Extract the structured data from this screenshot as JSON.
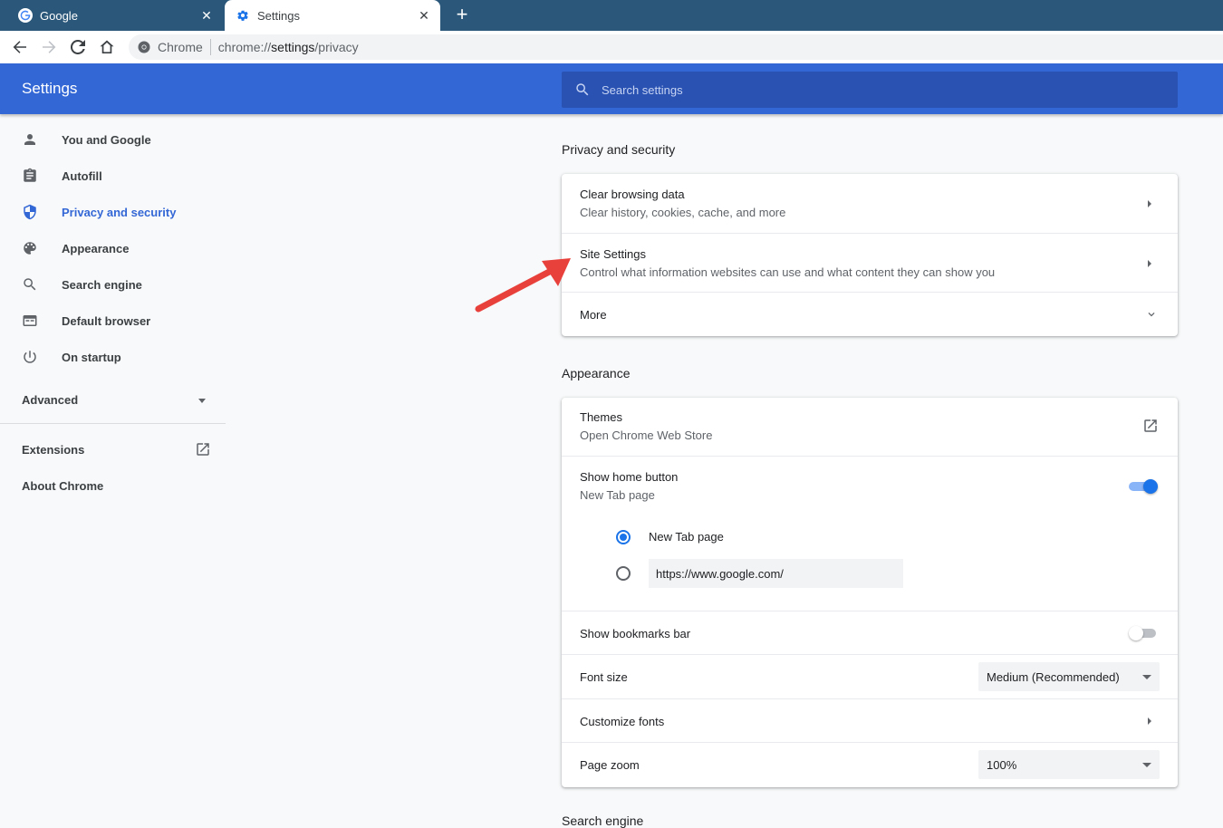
{
  "browser": {
    "tabs": [
      {
        "title": "Google",
        "icon": "google-g-icon",
        "active": false
      },
      {
        "title": "Settings",
        "icon": "gear-icon",
        "active": true
      }
    ],
    "close_glyph": "✕",
    "new_tab_glyph": "+",
    "omnibox": {
      "chip": "Chrome",
      "url_scheme": "chrome://",
      "url_host": "settings",
      "url_path": "/privacy"
    }
  },
  "header": {
    "title": "Settings",
    "search_placeholder": "Search settings"
  },
  "sidebar": {
    "items": [
      {
        "label": "You and Google",
        "icon": "person-icon",
        "selected": false
      },
      {
        "label": "Autofill",
        "icon": "clipboard-icon",
        "selected": false
      },
      {
        "label": "Privacy and security",
        "icon": "shield-icon",
        "selected": true
      },
      {
        "label": "Appearance",
        "icon": "palette-icon",
        "selected": false
      },
      {
        "label": "Search engine",
        "icon": "search-icon",
        "selected": false
      },
      {
        "label": "Default browser",
        "icon": "browser-window-icon",
        "selected": false
      },
      {
        "label": "On startup",
        "icon": "power-icon",
        "selected": false
      }
    ],
    "advanced_label": "Advanced",
    "extensions_label": "Extensions",
    "about_label": "About Chrome"
  },
  "privacy": {
    "title": "Privacy and security",
    "rows": [
      {
        "primary": "Clear browsing data",
        "secondary": "Clear history, cookies, cache, and more"
      },
      {
        "primary": "Site Settings",
        "secondary": "Control what information websites can use and what content they can show you"
      },
      {
        "primary": "More"
      }
    ]
  },
  "appearance": {
    "title": "Appearance",
    "themes": {
      "primary": "Themes",
      "secondary": "Open Chrome Web Store"
    },
    "home_button": {
      "primary": "Show home button",
      "secondary": "New Tab page",
      "enabled": true
    },
    "home_options": {
      "new_tab_label": "New Tab page",
      "custom_url_value": "https://www.google.com/",
      "selected": "new_tab"
    },
    "bookmarks_bar": {
      "label": "Show bookmarks bar",
      "enabled": false
    },
    "font_size": {
      "label": "Font size",
      "value": "Medium (Recommended)"
    },
    "customize_fonts": {
      "label": "Customize fonts"
    },
    "page_zoom": {
      "label": "Page zoom",
      "value": "100%"
    }
  },
  "next_section_title": "Search engine",
  "colors": {
    "tabstrip": "#2b587a",
    "header": "#3367d6",
    "search_bg": "#2a52b3",
    "accent": "#1a73e8",
    "annotation_arrow": "#e8413c"
  }
}
